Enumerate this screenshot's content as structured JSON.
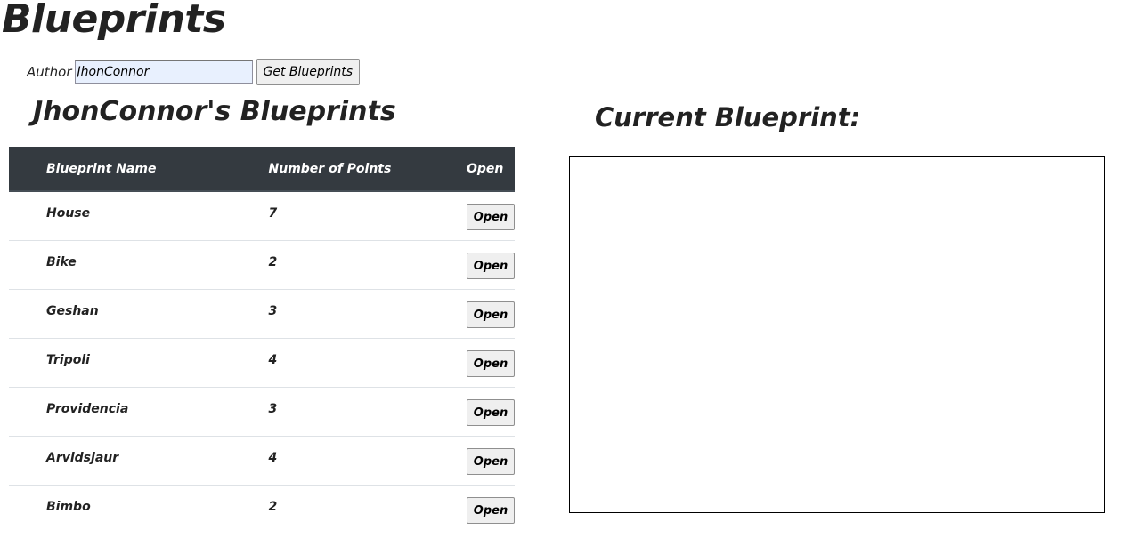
{
  "header": {
    "title": "Blueprints"
  },
  "search": {
    "author_label": "Author",
    "author_value": "JhonConnor",
    "button_label": "Get Blueprints"
  },
  "list": {
    "title": "JhonConnor's Blueprints",
    "columns": [
      "Blueprint Name",
      "Number of Points",
      "Open"
    ],
    "rows": [
      {
        "name": "House",
        "points": "7",
        "action": "Open"
      },
      {
        "name": "Bike",
        "points": "2",
        "action": "Open"
      },
      {
        "name": "Geshan",
        "points": "3",
        "action": "Open"
      },
      {
        "name": "Tripoli",
        "points": "4",
        "action": "Open"
      },
      {
        "name": "Providencia",
        "points": "3",
        "action": "Open"
      },
      {
        "name": "Arvidsjaur",
        "points": "4",
        "action": "Open"
      },
      {
        "name": "Bimbo",
        "points": "2",
        "action": "Open"
      }
    ]
  },
  "current": {
    "title": "Current Blueprint:"
  },
  "colors": {
    "table_header_bg": "#343a40",
    "input_autofill_bg": "#e8f0fe"
  }
}
